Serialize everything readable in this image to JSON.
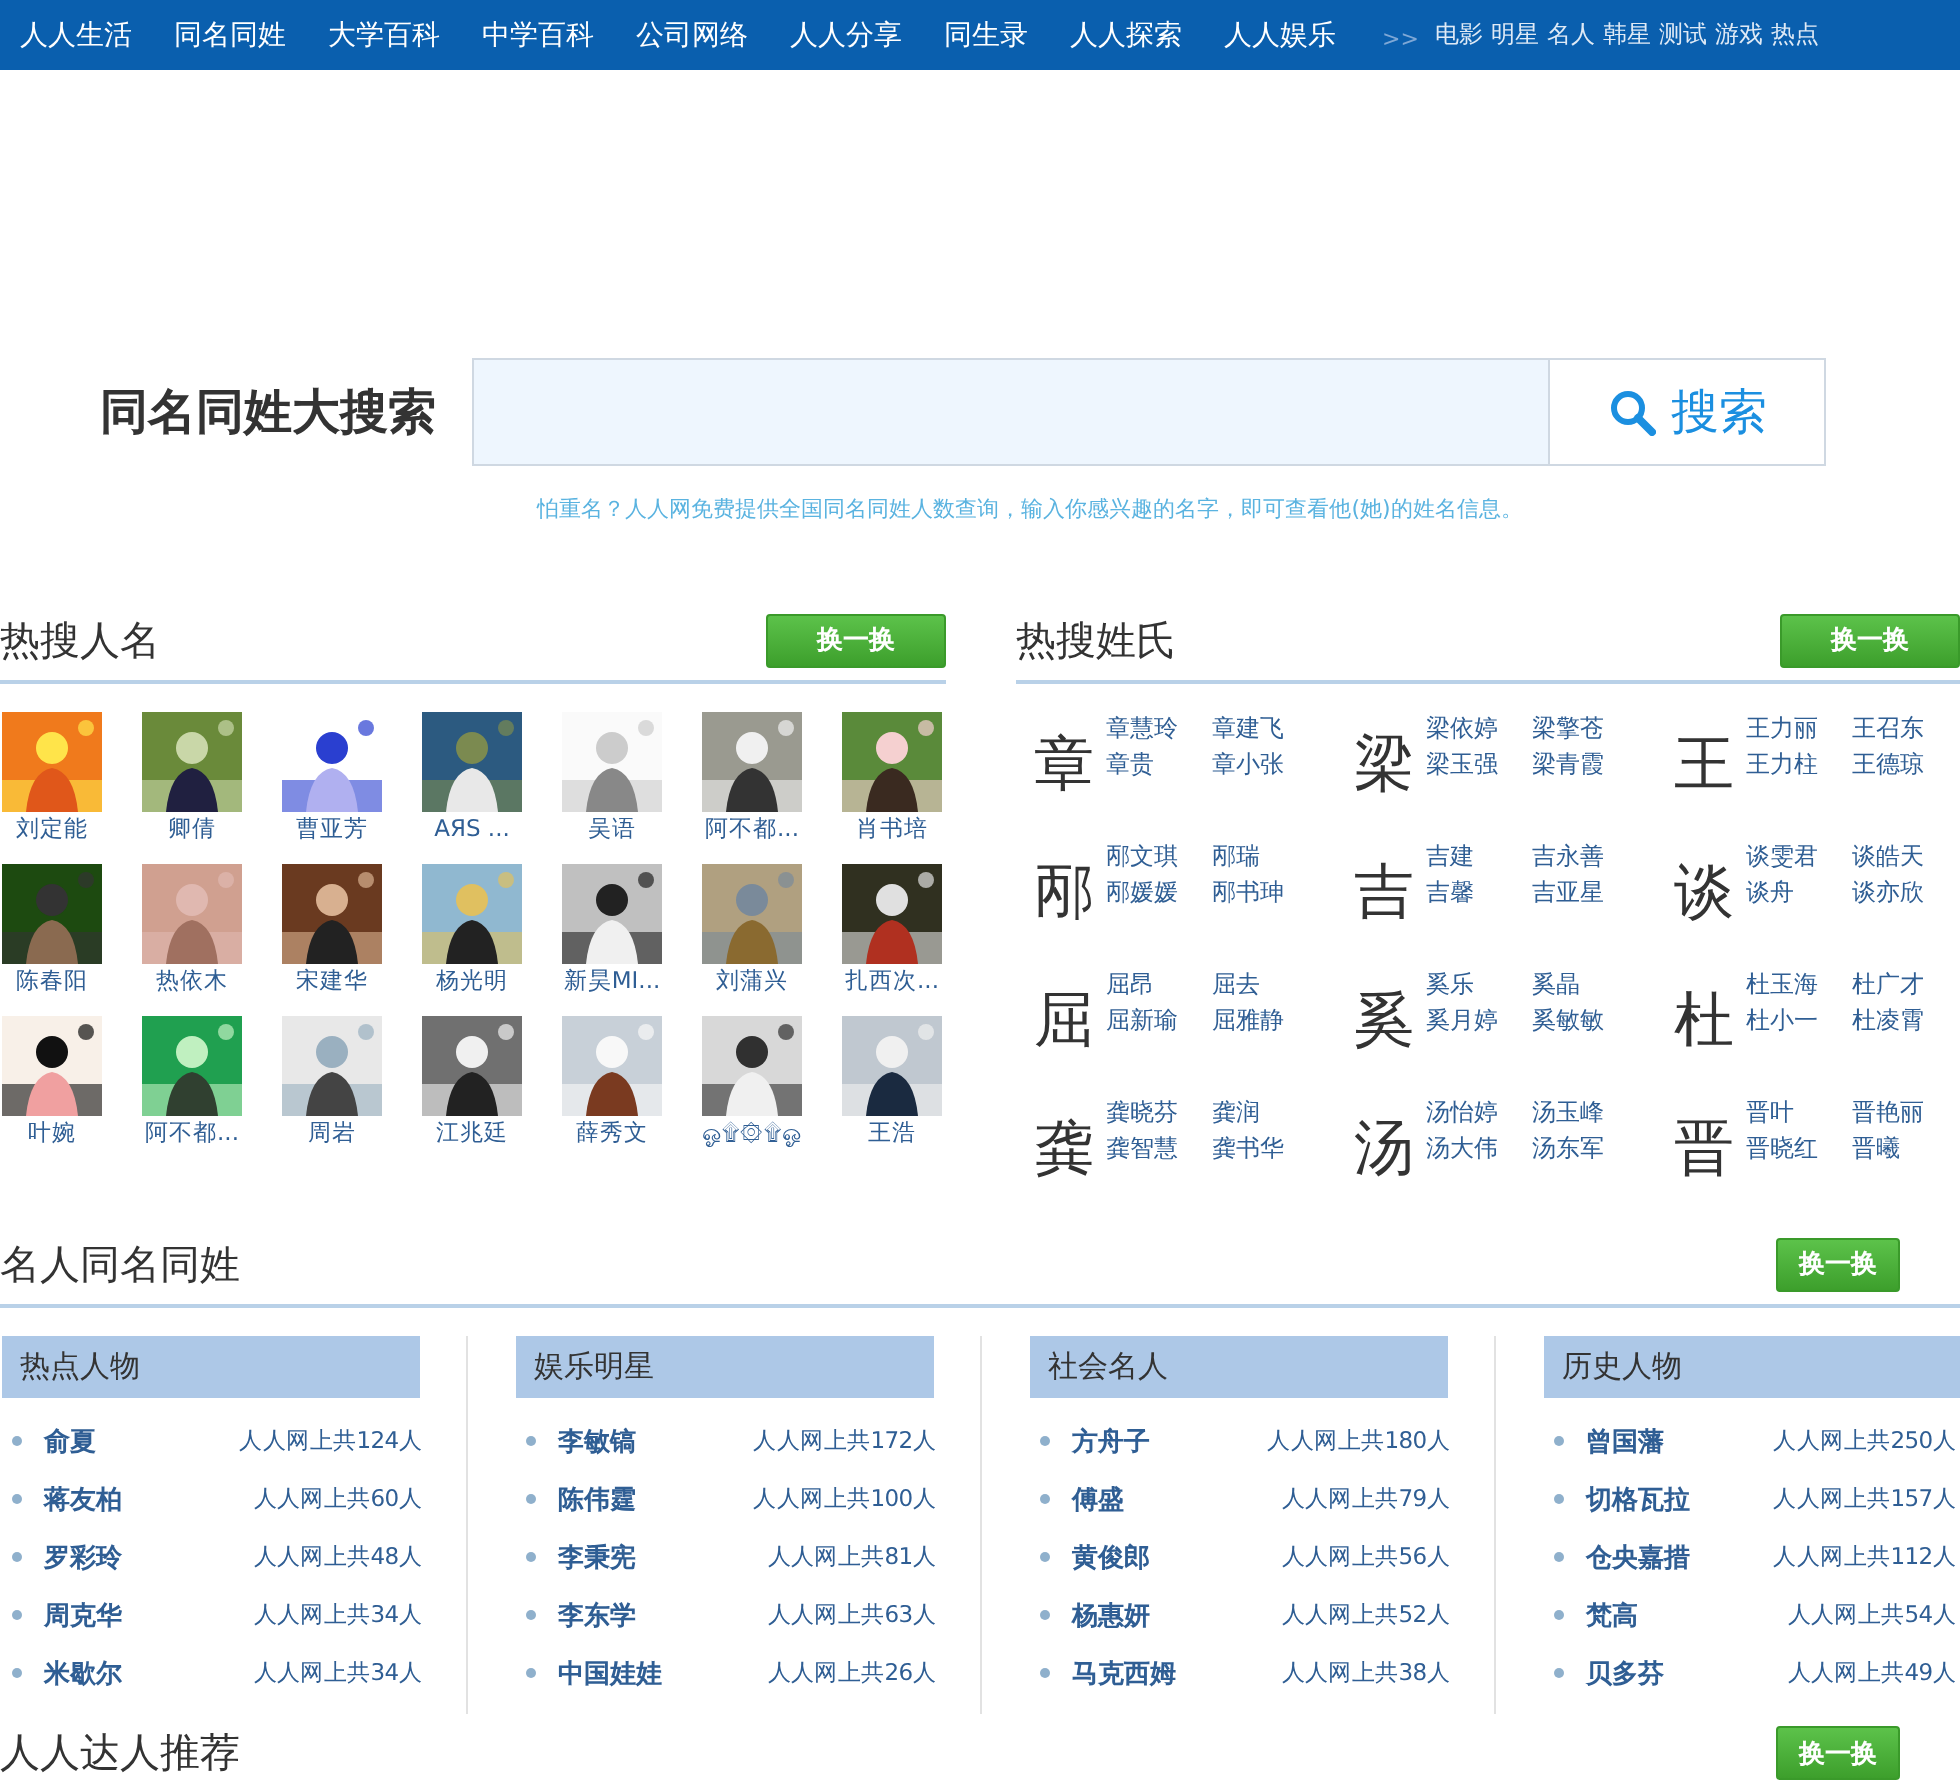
{
  "nav": {
    "items": [
      "人人生活",
      "同名同姓",
      "大学百科",
      "中学百科",
      "公司网络",
      "人人分享",
      "同生录",
      "人人探索",
      "人人娱乐"
    ],
    "separator": ">>",
    "sub_items": [
      "电影",
      "明星",
      "名人",
      "韩星",
      "测试",
      "游戏",
      "热点"
    ]
  },
  "search": {
    "title": "同名同姓大搜索",
    "button": "搜索",
    "hint": "怕重名？人人网免费提供全国同名同姓人数查询，输入你感兴趣的名字，即可查看他(她)的姓名信息。"
  },
  "hot_names": {
    "title": "热搜人名",
    "button": "换一换",
    "people": [
      {
        "name": "刘定能"
      },
      {
        "name": "卿倩"
      },
      {
        "name": "曹亚芳"
      },
      {
        "name": "AЯS ..."
      },
      {
        "name": "吴语"
      },
      {
        "name": "阿不都..."
      },
      {
        "name": "肖书培"
      },
      {
        "name": "陈春阳"
      },
      {
        "name": "热依木"
      },
      {
        "name": "宋建华"
      },
      {
        "name": "杨光明"
      },
      {
        "name": "新昊MI..."
      },
      {
        "name": "刘蒲兴"
      },
      {
        "name": "扎西次..."
      },
      {
        "name": "叶婉"
      },
      {
        "name": "阿不都..."
      },
      {
        "name": "周岩"
      },
      {
        "name": "江兆廷"
      },
      {
        "name": "薛秀文"
      },
      {
        "name": "ஓ۩۞۩ஓ"
      },
      {
        "name": "王浩"
      }
    ]
  },
  "hot_surnames": {
    "title": "热搜姓氏",
    "button": "换一换",
    "surnames": [
      {
        "surname": "章",
        "names": [
          "章慧玲",
          "章建飞",
          "章贵",
          "章小张"
        ]
      },
      {
        "surname": "梁",
        "names": [
          "梁依婷",
          "梁擎苍",
          "梁玉强",
          "梁青霞"
        ]
      },
      {
        "surname": "王",
        "names": [
          "王力丽",
          "王召东",
          "王力柱",
          "王德琼"
        ]
      },
      {
        "surname": "邴",
        "names": [
          "邴文琪",
          "邴瑞",
          "邴媛媛",
          "邴书珅"
        ]
      },
      {
        "surname": "吉",
        "names": [
          "吉建",
          "吉永善",
          "吉馨",
          "吉亚星"
        ]
      },
      {
        "surname": "谈",
        "names": [
          "谈雯君",
          "谈皓天",
          "谈舟",
          "谈亦欣"
        ]
      },
      {
        "surname": "屈",
        "names": [
          "屈昂",
          "屈去",
          "屈新瑜",
          "屈雅静"
        ]
      },
      {
        "surname": "奚",
        "names": [
          "奚乐",
          "奚晶",
          "奚月婷",
          "奚敏敏"
        ]
      },
      {
        "surname": "杜",
        "names": [
          "杜玉海",
          "杜广才",
          "杜小一",
          "杜凌霄"
        ]
      },
      {
        "surname": "龚",
        "names": [
          "龚晓芬",
          "龚润",
          "龚智慧",
          "龚书华"
        ]
      },
      {
        "surname": "汤",
        "names": [
          "汤怡婷",
          "汤玉峰",
          "汤大伟",
          "汤东军"
        ]
      },
      {
        "surname": "晋",
        "names": [
          "晋叶",
          "晋艳丽",
          "晋晓红",
          "晋曦"
        ]
      }
    ]
  },
  "celebrities": {
    "title": "名人同名同姓",
    "button": "换一换",
    "groups": [
      {
        "title": "热点人物",
        "rows": [
          {
            "name": "俞夏",
            "count": "人人网上共124人"
          },
          {
            "name": "蒋友柏",
            "count": "人人网上共60人"
          },
          {
            "name": "罗彩玲",
            "count": "人人网上共48人"
          },
          {
            "name": "周克华",
            "count": "人人网上共34人"
          },
          {
            "name": "米歇尔",
            "count": "人人网上共34人"
          }
        ]
      },
      {
        "title": "娱乐明星",
        "rows": [
          {
            "name": "李敏镐",
            "count": "人人网上共172人"
          },
          {
            "name": "陈伟霆",
            "count": "人人网上共100人"
          },
          {
            "name": "李秉宪",
            "count": "人人网上共81人"
          },
          {
            "name": "李东学",
            "count": "人人网上共63人"
          },
          {
            "name": "中国娃娃",
            "count": "人人网上共26人"
          }
        ]
      },
      {
        "title": "社会名人",
        "rows": [
          {
            "name": "方舟子",
            "count": "人人网上共180人"
          },
          {
            "name": "傅盛",
            "count": "人人网上共79人"
          },
          {
            "name": "黄俊郎",
            "count": "人人网上共56人"
          },
          {
            "name": "杨惠妍",
            "count": "人人网上共52人"
          },
          {
            "name": "马克西姆",
            "count": "人人网上共38人"
          }
        ]
      },
      {
        "title": "历史人物",
        "rows": [
          {
            "name": "曾国藩",
            "count": "人人网上共250人"
          },
          {
            "name": "切格瓦拉",
            "count": "人人网上共157人"
          },
          {
            "name": "仓央嘉措",
            "count": "人人网上共112人"
          },
          {
            "name": "梵高",
            "count": "人人网上共54人"
          },
          {
            "name": "贝多芬",
            "count": "人人网上共49人"
          }
        ]
      }
    ]
  },
  "experts": {
    "title": "人人达人推荐",
    "button": "换一换"
  }
}
